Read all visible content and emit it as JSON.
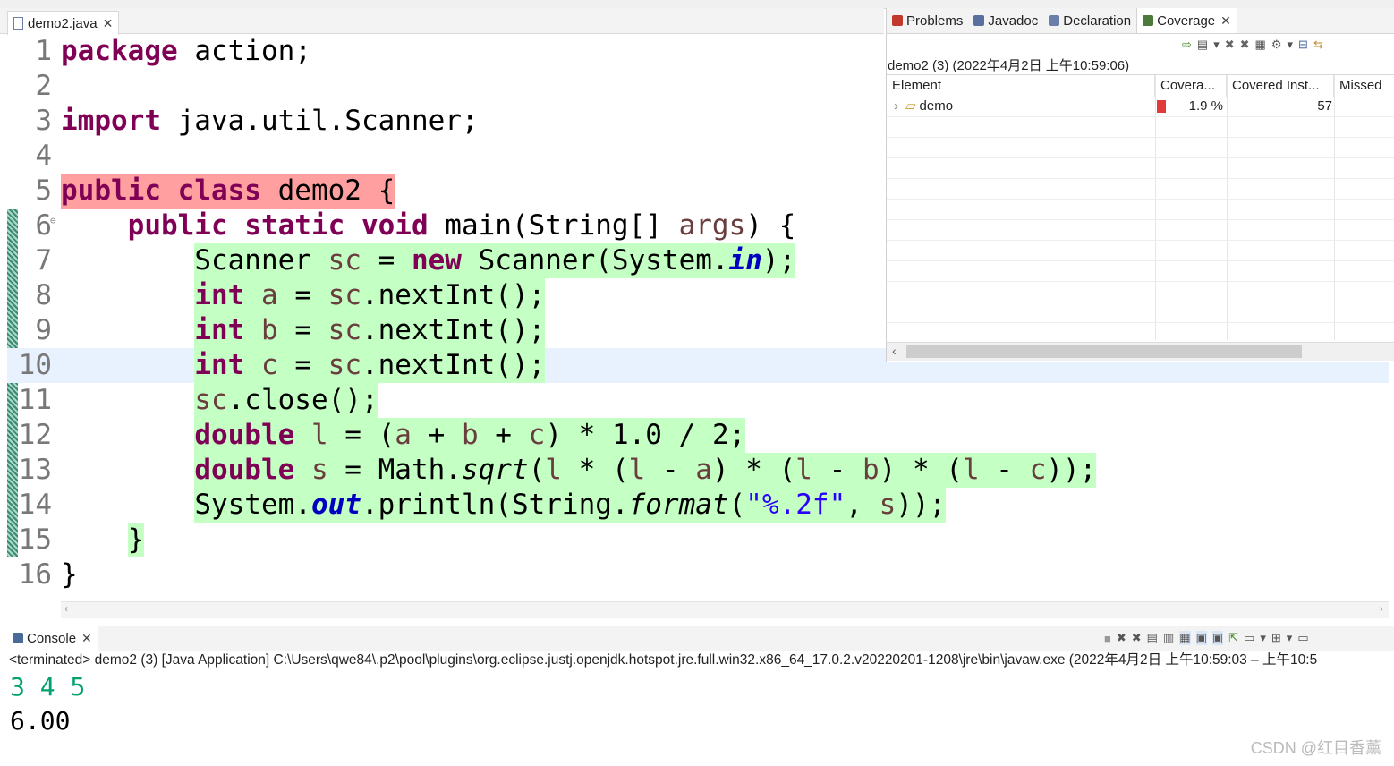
{
  "editor": {
    "tab_label": "demo2.java",
    "lines": [
      {
        "num": "1",
        "tokens": [
          {
            "t": "package",
            "c": "kw"
          },
          {
            "t": " action;"
          }
        ]
      },
      {
        "num": "2",
        "tokens": []
      },
      {
        "num": "3",
        "tokens": [
          {
            "t": "import",
            "c": "kw"
          },
          {
            "t": " java.util.Scanner;"
          }
        ]
      },
      {
        "num": "4",
        "tokens": []
      },
      {
        "num": "5",
        "bg": "#ff9f9f",
        "tokens": [
          {
            "t": "public",
            "c": "kw"
          },
          {
            "t": " "
          },
          {
            "t": "class",
            "c": "kw"
          },
          {
            "t": " demo2 {"
          }
        ]
      },
      {
        "num": "6",
        "tokens": [
          {
            "t": "    "
          },
          {
            "t": "public",
            "c": "kw"
          },
          {
            "t": " "
          },
          {
            "t": "static",
            "c": "kw"
          },
          {
            "t": " "
          },
          {
            "t": "void",
            "c": "kw"
          },
          {
            "t": " main(String[] "
          },
          {
            "t": "args",
            "c": "var"
          },
          {
            "t": ") {"
          }
        ]
      },
      {
        "num": "7",
        "bg": "#c4ffc4",
        "pre": "        ",
        "tokens": [
          {
            "t": "Scanner "
          },
          {
            "t": "sc",
            "c": "var"
          },
          {
            "t": " = "
          },
          {
            "t": "new",
            "c": "kw"
          },
          {
            "t": " Scanner(System."
          },
          {
            "t": "in",
            "c": "fld"
          },
          {
            "t": ");"
          }
        ]
      },
      {
        "num": "8",
        "bg": "#c4ffc4",
        "pre": "        ",
        "tokens": [
          {
            "t": "int",
            "c": "kw"
          },
          {
            "t": " "
          },
          {
            "t": "a",
            "c": "var"
          },
          {
            "t": " = "
          },
          {
            "t": "sc",
            "c": "var"
          },
          {
            "t": ".nextInt();"
          }
        ]
      },
      {
        "num": "9",
        "bg": "#c4ffc4",
        "pre": "        ",
        "tokens": [
          {
            "t": "int",
            "c": "kw"
          },
          {
            "t": " "
          },
          {
            "t": "b",
            "c": "var"
          },
          {
            "t": " = "
          },
          {
            "t": "sc",
            "c": "var"
          },
          {
            "t": ".nextInt();"
          }
        ]
      },
      {
        "num": "10",
        "bg": "#c4ffc4",
        "pre": "        ",
        "current": true,
        "tokens": [
          {
            "t": "int",
            "c": "kw"
          },
          {
            "t": " "
          },
          {
            "t": "c",
            "c": "var"
          },
          {
            "t": " = "
          },
          {
            "t": "sc",
            "c": "var"
          },
          {
            "t": ".nextInt();"
          }
        ]
      },
      {
        "num": "11",
        "bg": "#c4ffc4",
        "pre": "        ",
        "tokens": [
          {
            "t": "sc",
            "c": "var"
          },
          {
            "t": ".close();"
          }
        ]
      },
      {
        "num": "12",
        "bg": "#c4ffc4",
        "pre": "        ",
        "tokens": [
          {
            "t": "double",
            "c": "kw"
          },
          {
            "t": " "
          },
          {
            "t": "l",
            "c": "var"
          },
          {
            "t": " = ("
          },
          {
            "t": "a",
            "c": "var"
          },
          {
            "t": " + "
          },
          {
            "t": "b",
            "c": "var"
          },
          {
            "t": " + "
          },
          {
            "t": "c",
            "c": "var"
          },
          {
            "t": ") * 1.0 / 2;"
          }
        ]
      },
      {
        "num": "13",
        "bg": "#c4ffc4",
        "pre": "        ",
        "tokens": [
          {
            "t": "double",
            "c": "kw"
          },
          {
            "t": " "
          },
          {
            "t": "s",
            "c": "var"
          },
          {
            "t": " = Math."
          },
          {
            "t": "sqrt",
            "c": "ital"
          },
          {
            "t": "("
          },
          {
            "t": "l",
            "c": "var"
          },
          {
            "t": " * ("
          },
          {
            "t": "l",
            "c": "var"
          },
          {
            "t": " - "
          },
          {
            "t": "a",
            "c": "var"
          },
          {
            "t": ") * ("
          },
          {
            "t": "l",
            "c": "var"
          },
          {
            "t": " - "
          },
          {
            "t": "b",
            "c": "var"
          },
          {
            "t": ") * ("
          },
          {
            "t": "l",
            "c": "var"
          },
          {
            "t": " - "
          },
          {
            "t": "c",
            "c": "var"
          },
          {
            "t": "));"
          }
        ]
      },
      {
        "num": "14",
        "bg": "#c4ffc4",
        "pre": "        ",
        "tokens": [
          {
            "t": "System."
          },
          {
            "t": "out",
            "c": "fld"
          },
          {
            "t": ".println(String."
          },
          {
            "t": "format",
            "c": "ital"
          },
          {
            "t": "("
          },
          {
            "t": "\"%.2f\"",
            "c": "str"
          },
          {
            "t": ", "
          },
          {
            "t": "s",
            "c": "var"
          },
          {
            "t": "));"
          }
        ]
      },
      {
        "num": "15",
        "bg": "#c4ffc4",
        "pre": "    ",
        "tokens": [
          {
            "t": "}"
          }
        ]
      },
      {
        "num": "16",
        "tokens": [
          {
            "t": "}"
          }
        ]
      }
    ]
  },
  "coverage_panel": {
    "tabs": [
      {
        "label": "Problems",
        "icon": "problems-icon",
        "color": "#c0392b"
      },
      {
        "label": "Javadoc",
        "icon": "at-icon",
        "color": "#5a6fa0"
      },
      {
        "label": "Declaration",
        "icon": "declaration-icon",
        "color": "#6b7fa8"
      },
      {
        "label": "Coverage",
        "icon": "coverage-icon",
        "color": "#4b7a3a"
      }
    ],
    "session_label": "demo2 (3) (2022年4月2日 上午10:59:06)",
    "columns": [
      "Element",
      "Covera...",
      "Covered Inst...",
      "Missed"
    ],
    "rows": [
      {
        "element": "demo",
        "coverage": "1.9 %",
        "covered": "57",
        "missed": ""
      }
    ],
    "bar_color": "#e03a3a"
  },
  "console": {
    "tab_label": "Console",
    "terminated_text": "<terminated> demo2 (3) [Java Application] C:\\Users\\qwe84\\.p2\\pool\\plugins\\org.eclipse.justj.openjdk.hotspot.jre.full.win32.x86_64_17.0.2.v20220201-1208\\jre\\bin\\javaw.exe  (2022年4月2日 上午10:59:03 – 上午10:5",
    "input_line": "3 4 5",
    "output_line": "6.00",
    "input_color": "#00a070"
  },
  "watermark": "CSDN @红目香薰"
}
